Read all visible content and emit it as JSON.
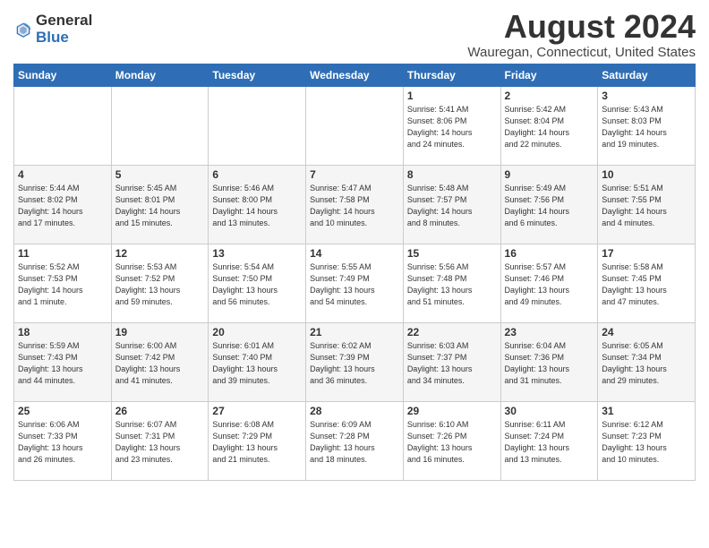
{
  "logo": {
    "general": "General",
    "blue": "Blue"
  },
  "title": "August 2024",
  "subtitle": "Wauregan, Connecticut, United States",
  "days_of_week": [
    "Sunday",
    "Monday",
    "Tuesday",
    "Wednesday",
    "Thursday",
    "Friday",
    "Saturday"
  ],
  "weeks": [
    [
      {
        "day": "",
        "data": ""
      },
      {
        "day": "",
        "data": ""
      },
      {
        "day": "",
        "data": ""
      },
      {
        "day": "",
        "data": ""
      },
      {
        "day": "1",
        "data": "Sunrise: 5:41 AM\nSunset: 8:06 PM\nDaylight: 14 hours\nand 24 minutes."
      },
      {
        "day": "2",
        "data": "Sunrise: 5:42 AM\nSunset: 8:04 PM\nDaylight: 14 hours\nand 22 minutes."
      },
      {
        "day": "3",
        "data": "Sunrise: 5:43 AM\nSunset: 8:03 PM\nDaylight: 14 hours\nand 19 minutes."
      }
    ],
    [
      {
        "day": "4",
        "data": "Sunrise: 5:44 AM\nSunset: 8:02 PM\nDaylight: 14 hours\nand 17 minutes."
      },
      {
        "day": "5",
        "data": "Sunrise: 5:45 AM\nSunset: 8:01 PM\nDaylight: 14 hours\nand 15 minutes."
      },
      {
        "day": "6",
        "data": "Sunrise: 5:46 AM\nSunset: 8:00 PM\nDaylight: 14 hours\nand 13 minutes."
      },
      {
        "day": "7",
        "data": "Sunrise: 5:47 AM\nSunset: 7:58 PM\nDaylight: 14 hours\nand 10 minutes."
      },
      {
        "day": "8",
        "data": "Sunrise: 5:48 AM\nSunset: 7:57 PM\nDaylight: 14 hours\nand 8 minutes."
      },
      {
        "day": "9",
        "data": "Sunrise: 5:49 AM\nSunset: 7:56 PM\nDaylight: 14 hours\nand 6 minutes."
      },
      {
        "day": "10",
        "data": "Sunrise: 5:51 AM\nSunset: 7:55 PM\nDaylight: 14 hours\nand 4 minutes."
      }
    ],
    [
      {
        "day": "11",
        "data": "Sunrise: 5:52 AM\nSunset: 7:53 PM\nDaylight: 14 hours\nand 1 minute."
      },
      {
        "day": "12",
        "data": "Sunrise: 5:53 AM\nSunset: 7:52 PM\nDaylight: 13 hours\nand 59 minutes."
      },
      {
        "day": "13",
        "data": "Sunrise: 5:54 AM\nSunset: 7:50 PM\nDaylight: 13 hours\nand 56 minutes."
      },
      {
        "day": "14",
        "data": "Sunrise: 5:55 AM\nSunset: 7:49 PM\nDaylight: 13 hours\nand 54 minutes."
      },
      {
        "day": "15",
        "data": "Sunrise: 5:56 AM\nSunset: 7:48 PM\nDaylight: 13 hours\nand 51 minutes."
      },
      {
        "day": "16",
        "data": "Sunrise: 5:57 AM\nSunset: 7:46 PM\nDaylight: 13 hours\nand 49 minutes."
      },
      {
        "day": "17",
        "data": "Sunrise: 5:58 AM\nSunset: 7:45 PM\nDaylight: 13 hours\nand 47 minutes."
      }
    ],
    [
      {
        "day": "18",
        "data": "Sunrise: 5:59 AM\nSunset: 7:43 PM\nDaylight: 13 hours\nand 44 minutes."
      },
      {
        "day": "19",
        "data": "Sunrise: 6:00 AM\nSunset: 7:42 PM\nDaylight: 13 hours\nand 41 minutes."
      },
      {
        "day": "20",
        "data": "Sunrise: 6:01 AM\nSunset: 7:40 PM\nDaylight: 13 hours\nand 39 minutes."
      },
      {
        "day": "21",
        "data": "Sunrise: 6:02 AM\nSunset: 7:39 PM\nDaylight: 13 hours\nand 36 minutes."
      },
      {
        "day": "22",
        "data": "Sunrise: 6:03 AM\nSunset: 7:37 PM\nDaylight: 13 hours\nand 34 minutes."
      },
      {
        "day": "23",
        "data": "Sunrise: 6:04 AM\nSunset: 7:36 PM\nDaylight: 13 hours\nand 31 minutes."
      },
      {
        "day": "24",
        "data": "Sunrise: 6:05 AM\nSunset: 7:34 PM\nDaylight: 13 hours\nand 29 minutes."
      }
    ],
    [
      {
        "day": "25",
        "data": "Sunrise: 6:06 AM\nSunset: 7:33 PM\nDaylight: 13 hours\nand 26 minutes."
      },
      {
        "day": "26",
        "data": "Sunrise: 6:07 AM\nSunset: 7:31 PM\nDaylight: 13 hours\nand 23 minutes."
      },
      {
        "day": "27",
        "data": "Sunrise: 6:08 AM\nSunset: 7:29 PM\nDaylight: 13 hours\nand 21 minutes."
      },
      {
        "day": "28",
        "data": "Sunrise: 6:09 AM\nSunset: 7:28 PM\nDaylight: 13 hours\nand 18 minutes."
      },
      {
        "day": "29",
        "data": "Sunrise: 6:10 AM\nSunset: 7:26 PM\nDaylight: 13 hours\nand 16 minutes."
      },
      {
        "day": "30",
        "data": "Sunrise: 6:11 AM\nSunset: 7:24 PM\nDaylight: 13 hours\nand 13 minutes."
      },
      {
        "day": "31",
        "data": "Sunrise: 6:12 AM\nSunset: 7:23 PM\nDaylight: 13 hours\nand 10 minutes."
      }
    ]
  ]
}
